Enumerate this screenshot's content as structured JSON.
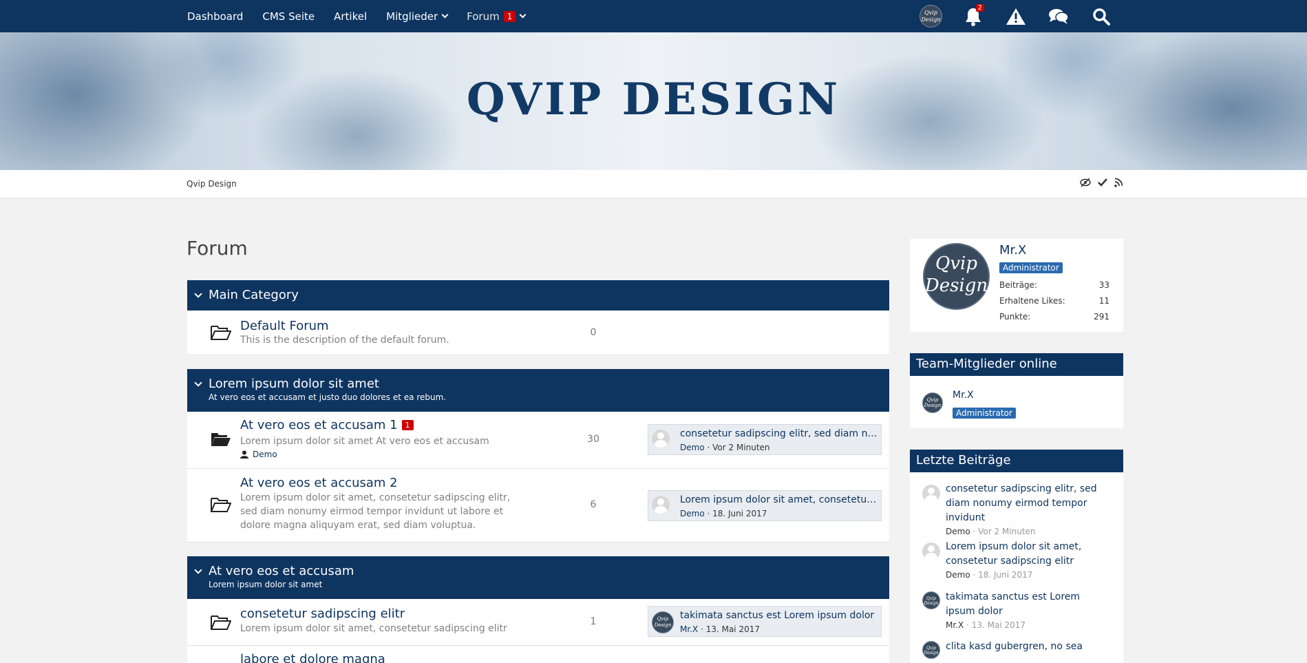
{
  "nav": {
    "items": [
      {
        "label": "Dashboard"
      },
      {
        "label": "CMS Seite"
      },
      {
        "label": "Artikel"
      },
      {
        "label": "Mitglieder"
      },
      {
        "label": "Forum",
        "badge": "1"
      }
    ],
    "notification_count": "2",
    "avatar_text": "Qvip Design"
  },
  "banner": {
    "title": "QVIP DESIGN"
  },
  "breadcrumb": {
    "label": "Qvip Design"
  },
  "page": {
    "title": "Forum"
  },
  "categories": [
    {
      "title": "Main Category",
      "description": "",
      "boards": [
        {
          "title": "Default Forum",
          "description": "This is the description of the default forum.",
          "count": "0"
        }
      ]
    },
    {
      "title": "Lorem ipsum dolor sit amet",
      "description": "At vero eos et accusam et justo duo dolores et ea rebum.",
      "boards": [
        {
          "title": "At vero eos et accusam 1",
          "badge": "1",
          "description": "Lorem ipsum dolor sit amet At vero eos et accusam",
          "user": "Demo",
          "count": "30",
          "last_post": {
            "title": "consetetur sadipscing elitr, sed diam nonumy eirmod tempor invidunt",
            "user": "Demo",
            "time": "Vor 2 Minuten"
          }
        },
        {
          "title": "At vero eos et accusam 2",
          "description": "Lorem ipsum dolor sit amet, consetetur sadipscing elitr, sed diam nonumy eirmod tempor invidunt ut labore et dolore magna aliquyam erat, sed diam voluptua.",
          "count": "6",
          "last_post": {
            "title": "Lorem ipsum dolor sit amet, consetetur sadipscing elitr",
            "user": "Demo",
            "time": "18. Juni 2017"
          }
        }
      ]
    },
    {
      "title": "At vero eos et accusam",
      "description": "Lorem ipsum dolor sit amet",
      "boards": [
        {
          "title": "consetetur sadipscing elitr",
          "description": "Lorem ipsum dolor sit amet, consetetur sadipscing elitr",
          "count": "1",
          "last_post": {
            "title": "takimata sanctus est Lorem ipsum dolor",
            "user": "Mr.X",
            "time": "13. Mai 2017"
          }
        },
        {
          "title": "labore et dolore magna"
        }
      ]
    }
  ],
  "profile": {
    "name": "Mr.X",
    "role": "Administrator",
    "avatar_text": "Qvip Design",
    "stats": [
      {
        "label": "Beiträge:",
        "value": "33"
      },
      {
        "label": "Erhaltene Likes:",
        "value": "11"
      },
      {
        "label": "Punkte:",
        "value": "291"
      }
    ]
  },
  "team_online": {
    "title": "Team-Mitglieder online",
    "members": [
      {
        "name": "Mr.X",
        "role": "Administrator"
      }
    ]
  },
  "recent_posts": {
    "title": "Letzte Beiträge",
    "items": [
      {
        "title": "consetetur sadipscing elitr, sed diam nonumy eirmod tempor invidunt",
        "user": "Demo",
        "time": "Vor 2 Minuten"
      },
      {
        "title": "Lorem ipsum dolor sit amet, consetetur sadipscing elitr",
        "user": "Demo",
        "time": "18. Juni 2017"
      },
      {
        "title": "takimata sanctus est Lorem ipsum dolor",
        "user": "Mr.X",
        "time": "13. Mai 2017"
      },
      {
        "title": "clita kasd gubergren, no sea"
      }
    ]
  },
  "colors": {
    "primary": "#0e3460",
    "badge_red": "#cc0000",
    "role_badge": "#2a6bb0"
  }
}
